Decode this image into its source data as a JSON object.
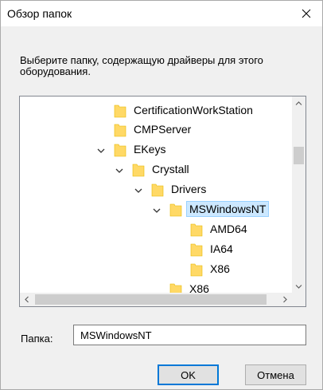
{
  "dialog": {
    "title": "Обзор папок",
    "instruction": "Выберите папку, содержащую драйверы для этого оборудования."
  },
  "tree": {
    "nodes": [
      {
        "label": "CertificationWorkStation",
        "expanded": false
      },
      {
        "label": "CMPServer",
        "expanded": false
      },
      {
        "label": "EKeys",
        "expanded": true
      },
      {
        "label": "Crystall",
        "expanded": true
      },
      {
        "label": "Drivers",
        "expanded": true
      },
      {
        "label": "MSWindowsNT",
        "expanded": true,
        "selected": true
      },
      {
        "label": "AMD64",
        "expanded": false
      },
      {
        "label": "IA64",
        "expanded": false
      },
      {
        "label": "X86",
        "expanded": false
      },
      {
        "label": "X86",
        "expanded": false
      }
    ]
  },
  "folder_field": {
    "label": "Папка:",
    "value": "MSWindowsNT"
  },
  "buttons": {
    "ok": "OK",
    "cancel": "Отмена"
  },
  "colors": {
    "selection_bg": "#cce8ff",
    "selection_border": "#99d1ff",
    "folder_yellow": "#ffd966",
    "default_button_border": "#0078d7"
  },
  "icons": {
    "folder": "folder-icon",
    "expand": "chevron-down-icon",
    "close": "close-icon"
  }
}
